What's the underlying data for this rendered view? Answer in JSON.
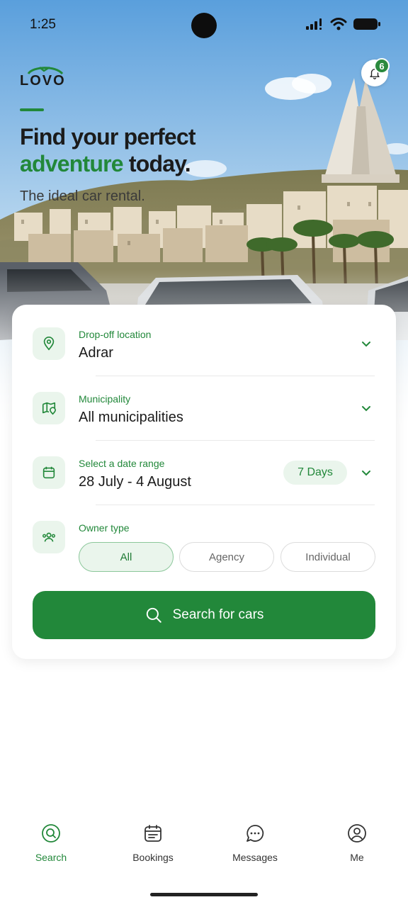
{
  "status": {
    "time": "1:25"
  },
  "brand": {
    "logo_text": "LOVO",
    "accent": "#22883a"
  },
  "notifications": {
    "count": "6"
  },
  "hero": {
    "title_line1": "Find your perfect",
    "title_highlight": "adventure",
    "title_rest": " today.",
    "subtitle": "The ideal car rental."
  },
  "form": {
    "location": {
      "label": "Drop-off location",
      "value": "Adrar"
    },
    "municipality": {
      "label": "Municipality",
      "value": "All municipalities"
    },
    "dates": {
      "label": "Select a date range",
      "value": "28 July - 4 August",
      "duration": "7 Days"
    },
    "owner": {
      "label": "Owner type",
      "options": [
        "All",
        "Agency",
        "Individual"
      ],
      "selected": "All"
    },
    "search_label": "Search for cars"
  },
  "nav": {
    "items": [
      {
        "label": "Search",
        "icon": "search-icon",
        "active": true
      },
      {
        "label": "Bookings",
        "icon": "bookings-icon",
        "active": false
      },
      {
        "label": "Messages",
        "icon": "messages-icon",
        "active": false
      },
      {
        "label": "Me",
        "icon": "profile-icon",
        "active": false
      }
    ]
  }
}
